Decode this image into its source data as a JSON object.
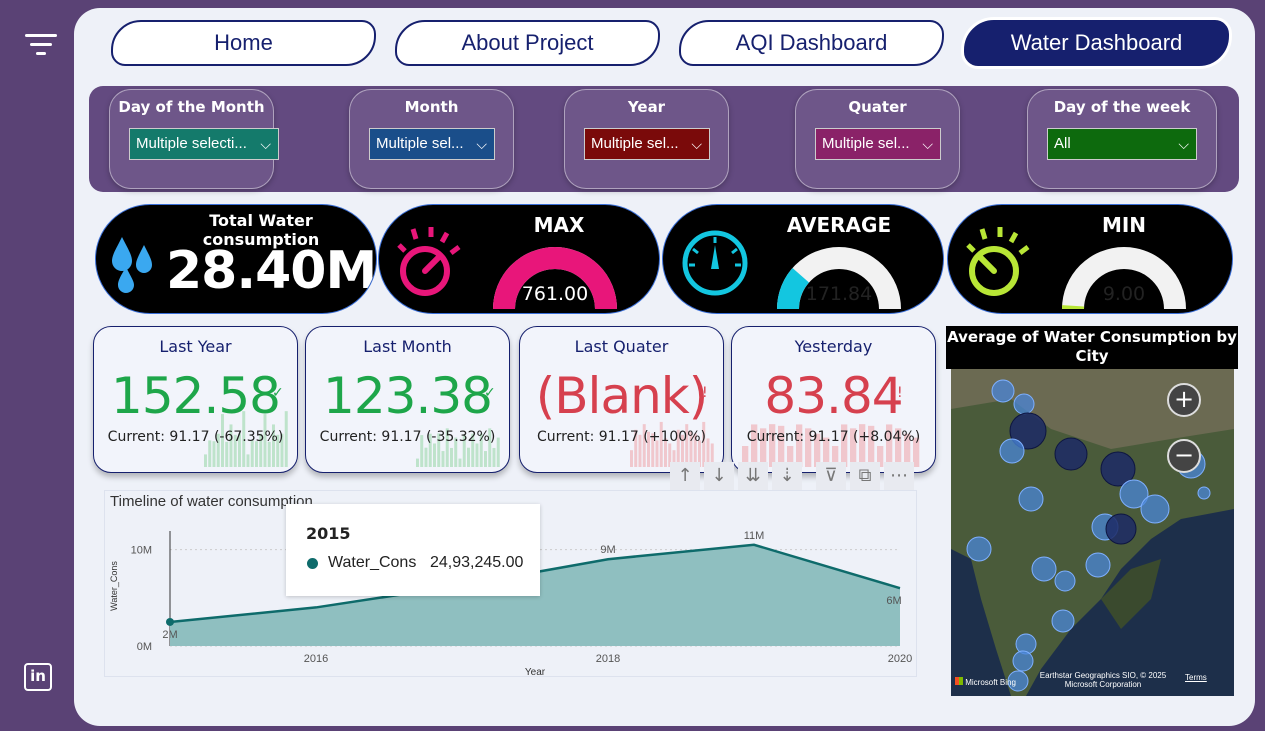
{
  "nav": {
    "home": "Home",
    "about": "About Project",
    "aqi": "AQI Dashboard",
    "water": "Water Dashboard"
  },
  "filters": [
    {
      "title": "Day of the Month",
      "value": "Multiple selecti...",
      "color": "#147a6b"
    },
    {
      "title": "Month",
      "value": "Multiple sel...",
      "color": "#1a4e8a"
    },
    {
      "title": "Year",
      "value": "Multiple sel...",
      "color": "#7a0a0a"
    },
    {
      "title": "Quater",
      "value": "Multiple sel...",
      "color": "#8a2268"
    },
    {
      "title": "Day of the week",
      "value": "All",
      "color": "#0d6a0d"
    }
  ],
  "kpis": {
    "total": {
      "title": "Total Water consumption",
      "value": "28.40M",
      "icon": "water-drops-icon"
    },
    "max": {
      "title": "MAX",
      "value": "761.00",
      "fill": 1.0,
      "color": "#e8167a",
      "icon": "gauge-pink-icon"
    },
    "average": {
      "title": "AVERAGE",
      "value": "171.84",
      "fill": 0.23,
      "color": "#13c6e0",
      "icon": "speedometer-icon"
    },
    "min": {
      "title": "MIN",
      "value": "9.00",
      "fill": 0.02,
      "color": "#b8e636",
      "icon": "gauge-green-icon"
    }
  },
  "cards": [
    {
      "title": "Last Year",
      "value": "152.58",
      "sub": "Current: 91.17 (-67.35%)",
      "color": "#1ea64a",
      "mark": "✓"
    },
    {
      "title": "Last Month",
      "value": "123.38",
      "sub": "Current: 91.17 (-35.32%)",
      "color": "#1ea64a",
      "mark": "✓"
    },
    {
      "title": "Last Quater",
      "value": "(Blank)",
      "sub": "Current: 91.17 (+100%)",
      "color": "#d6404e",
      "mark": "!"
    },
    {
      "title": "Yesterday",
      "value": "83.84",
      "sub": "Current: 91.17 (+8.04%)",
      "color": "#d6404e",
      "mark": "!"
    }
  ],
  "timeline": {
    "title": "Timeline of water consumption",
    "tooltip": {
      "year": "2015",
      "series": "Water_Cons",
      "value": "24,93,245.00"
    }
  },
  "chart_data": {
    "type": "area",
    "title": "Timeline of water consumption",
    "xlabel": "Year",
    "ylabel": "Water_Cons",
    "x": [
      2015,
      2016,
      2017,
      2018,
      2019,
      2020
    ],
    "values": [
      2493245,
      4000000,
      6300000,
      9000000,
      10500000,
      6000000
    ],
    "data_labels": [
      "2M",
      "",
      "",
      "9M",
      "11M",
      "6M"
    ],
    "x_ticks": [
      "2016",
      "2018",
      "2020"
    ],
    "y_ticks": [
      "0M",
      "10M"
    ],
    "ylim": [
      0,
      14000000
    ],
    "color": "#0e6b6b"
  },
  "map": {
    "title": "Average of Water Consumption by City",
    "attribution": "Earthstar Geographics SIO, © 2025 Microsoft Corporation",
    "terms": "Terms",
    "brand": "Microsoft Bing",
    "zoom_in": "+",
    "zoom_out": "−"
  },
  "toolbar": [
    "↑",
    "↓",
    "⇊",
    "⇣",
    "⊽",
    "⧉",
    "⋯"
  ],
  "social": "in"
}
